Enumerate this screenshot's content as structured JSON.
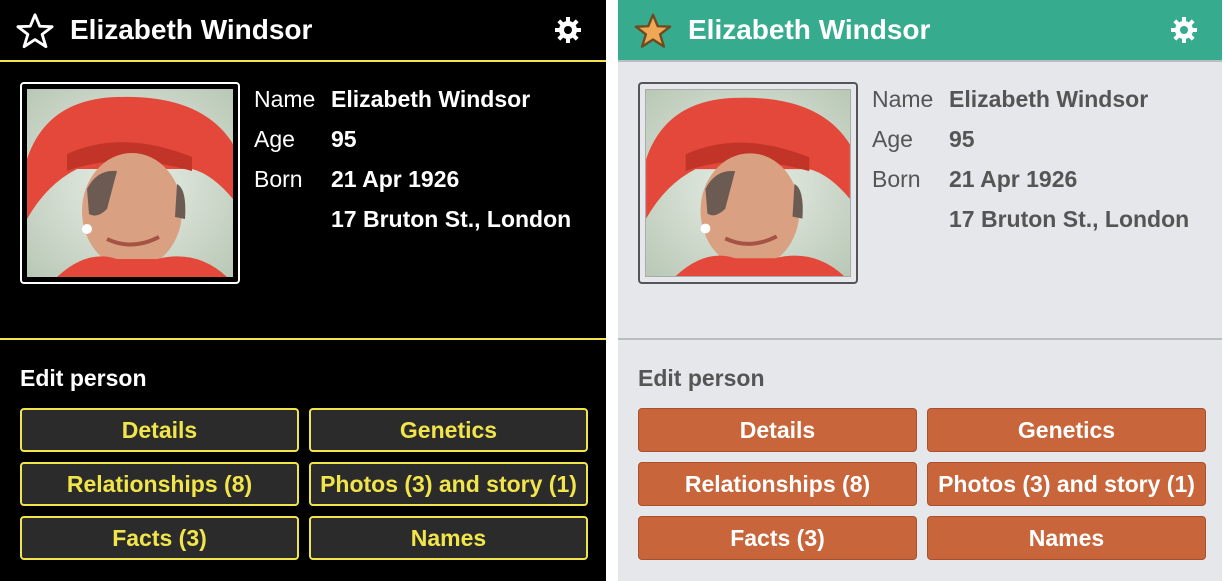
{
  "person": {
    "title": "Elizabeth Windsor",
    "fields": [
      {
        "label": "Name",
        "value": "Elizabeth Windsor"
      },
      {
        "label": "Age",
        "value": "95"
      },
      {
        "label": "Born",
        "value": "21 Apr 1926"
      },
      {
        "label": "",
        "value": "17 Bruton St., London"
      }
    ]
  },
  "edit": {
    "title": "Edit person",
    "buttons": [
      "Details",
      "Genetics",
      "Relationships (8)",
      "Photos (3) and story (1)",
      "Facts (3)",
      "Names"
    ]
  },
  "themes": {
    "dark": {
      "background": "#000000",
      "accent": "#f1e54b",
      "button_bg": "#2b2b2b",
      "star": "outline-white"
    },
    "light": {
      "background": "#e6e7ea",
      "header": "#36ab8e",
      "button_bg": "#c8653a",
      "star": "filled-orange"
    }
  },
  "icons": [
    "star-icon",
    "gear-icon"
  ]
}
